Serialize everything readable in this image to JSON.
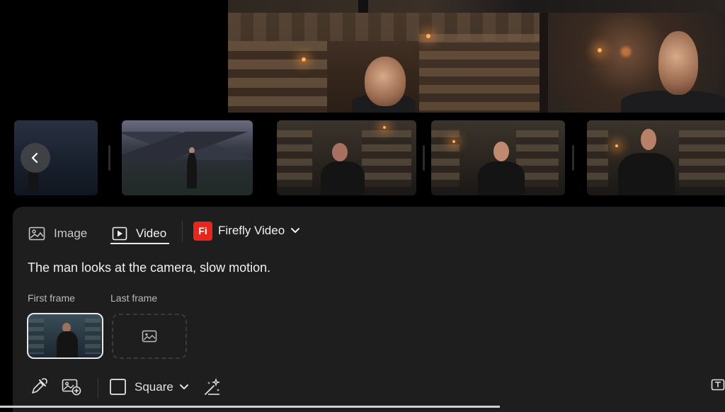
{
  "tabs": [
    {
      "label": "Image",
      "icon": "image-icon",
      "active": false
    },
    {
      "label": "Video",
      "icon": "video-play-icon",
      "active": true
    }
  ],
  "model": {
    "badge": "Fi",
    "label": "Firefly Video",
    "badge_color": "#e9261d"
  },
  "prompt": {
    "text": "The man looks at the camera, slow motion."
  },
  "frames": {
    "first_label": "First frame",
    "last_label": "Last frame"
  },
  "toolbar": {
    "aspect_label": "Square",
    "icons": [
      "eyedropper-icon",
      "add-image-icon",
      "chevron-down-icon",
      "magic-wand-icon",
      "text-icon"
    ]
  },
  "navigation": {
    "prev_icon": "chevron-left-icon"
  }
}
